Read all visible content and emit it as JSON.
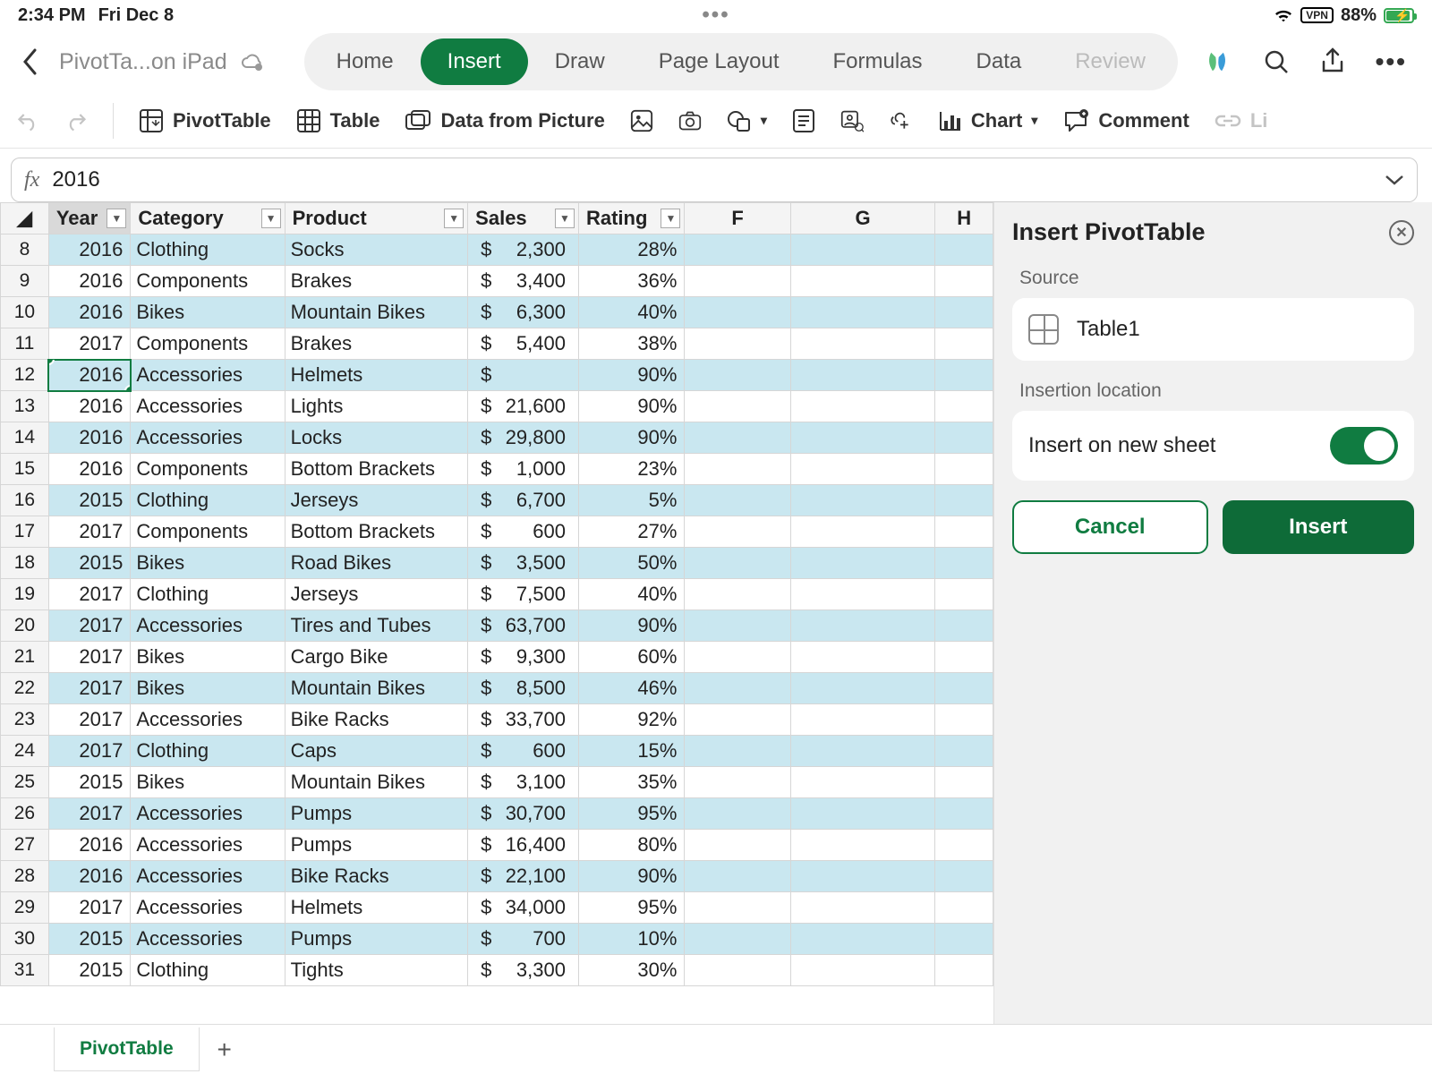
{
  "status": {
    "time": "2:34 PM",
    "date": "Fri Dec 8",
    "vpn": "VPN",
    "battery": "88%"
  },
  "doc": {
    "name": "PivotTa...on iPad"
  },
  "tabs": [
    "Home",
    "Insert",
    "Draw",
    "Page Layout",
    "Formulas",
    "Data",
    "Review"
  ],
  "activeTab": "Insert",
  "ribbon": {
    "pivottable": "PivotTable",
    "table": "Table",
    "datapic": "Data from Picture",
    "chart": "Chart",
    "comment": "Comment",
    "link": "Li"
  },
  "formula": {
    "label": "fx",
    "value": "2016"
  },
  "columns": [
    "Year",
    "Category",
    "Product",
    "Sales",
    "Rating",
    "F",
    "G",
    "H"
  ],
  "extraCols": [
    "F",
    "G",
    "H"
  ],
  "rows": [
    {
      "n": 8,
      "year": "2016",
      "cat": "Clothing",
      "prod": "Socks",
      "sales": "2,300",
      "rating": "28%"
    },
    {
      "n": 9,
      "year": "2016",
      "cat": "Components",
      "prod": "Brakes",
      "sales": "3,400",
      "rating": "36%"
    },
    {
      "n": 10,
      "year": "2016",
      "cat": "Bikes",
      "prod": "Mountain Bikes",
      "sales": "6,300",
      "rating": "40%"
    },
    {
      "n": 11,
      "year": "2017",
      "cat": "Components",
      "prod": "Brakes",
      "sales": "5,400",
      "rating": "38%"
    },
    {
      "n": 12,
      "year": "2016",
      "cat": "Accessories",
      "prod": "Helmets",
      "sales": "",
      "rating": "90%",
      "sel": true
    },
    {
      "n": 13,
      "year": "2016",
      "cat": "Accessories",
      "prod": "Lights",
      "sales": "21,600",
      "rating": "90%"
    },
    {
      "n": 14,
      "year": "2016",
      "cat": "Accessories",
      "prod": "Locks",
      "sales": "29,800",
      "rating": "90%"
    },
    {
      "n": 15,
      "year": "2016",
      "cat": "Components",
      "prod": "Bottom Brackets",
      "sales": "1,000",
      "rating": "23%"
    },
    {
      "n": 16,
      "year": "2015",
      "cat": "Clothing",
      "prod": "Jerseys",
      "sales": "6,700",
      "rating": "5%"
    },
    {
      "n": 17,
      "year": "2017",
      "cat": "Components",
      "prod": "Bottom Brackets",
      "sales": "600",
      "rating": "27%"
    },
    {
      "n": 18,
      "year": "2015",
      "cat": "Bikes",
      "prod": "Road Bikes",
      "sales": "3,500",
      "rating": "50%"
    },
    {
      "n": 19,
      "year": "2017",
      "cat": "Clothing",
      "prod": "Jerseys",
      "sales": "7,500",
      "rating": "40%"
    },
    {
      "n": 20,
      "year": "2017",
      "cat": "Accessories",
      "prod": "Tires and Tubes",
      "sales": "63,700",
      "rating": "90%"
    },
    {
      "n": 21,
      "year": "2017",
      "cat": "Bikes",
      "prod": "Cargo Bike",
      "sales": "9,300",
      "rating": "60%"
    },
    {
      "n": 22,
      "year": "2017",
      "cat": "Bikes",
      "prod": "Mountain Bikes",
      "sales": "8,500",
      "rating": "46%"
    },
    {
      "n": 23,
      "year": "2017",
      "cat": "Accessories",
      "prod": "Bike Racks",
      "sales": "33,700",
      "rating": "92%"
    },
    {
      "n": 24,
      "year": "2017",
      "cat": "Clothing",
      "prod": "Caps",
      "sales": "600",
      "rating": "15%"
    },
    {
      "n": 25,
      "year": "2015",
      "cat": "Bikes",
      "prod": "Mountain Bikes",
      "sales": "3,100",
      "rating": "35%"
    },
    {
      "n": 26,
      "year": "2017",
      "cat": "Accessories",
      "prod": "Pumps",
      "sales": "30,700",
      "rating": "95%"
    },
    {
      "n": 27,
      "year": "2016",
      "cat": "Accessories",
      "prod": "Pumps",
      "sales": "16,400",
      "rating": "80%"
    },
    {
      "n": 28,
      "year": "2016",
      "cat": "Accessories",
      "prod": "Bike Racks",
      "sales": "22,100",
      "rating": "90%"
    },
    {
      "n": 29,
      "year": "2017",
      "cat": "Accessories",
      "prod": "Helmets",
      "sales": "34,000",
      "rating": "95%"
    },
    {
      "n": 30,
      "year": "2015",
      "cat": "Accessories",
      "prod": "Pumps",
      "sales": "700",
      "rating": "10%"
    },
    {
      "n": 31,
      "year": "2015",
      "cat": "Clothing",
      "prod": "Tights",
      "sales": "3,300",
      "rating": "30%"
    }
  ],
  "panel": {
    "title": "Insert PivotTable",
    "sourceLabel": "Source",
    "sourceValue": "Table1",
    "locLabel": "Insertion location",
    "locOption": "Insert on new sheet",
    "cancel": "Cancel",
    "insert": "Insert"
  },
  "sheetTab": "PivotTable"
}
